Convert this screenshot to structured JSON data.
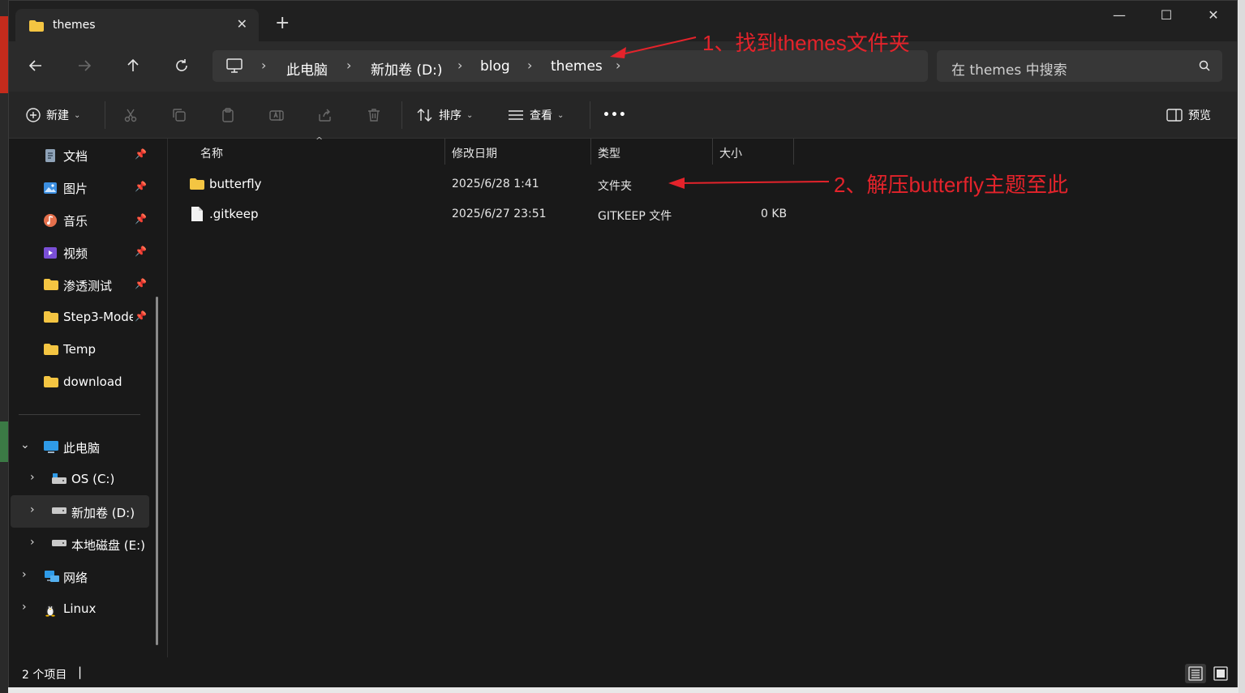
{
  "window": {
    "tab_title": "themes",
    "tab_close": "✕",
    "new_tab": "+"
  },
  "controls": {
    "minimize": "—",
    "maximize": "☐",
    "close": "✕"
  },
  "nav": {
    "breadcrumb": [
      "此电脑",
      "新加卷 (D:)",
      "blog",
      "themes"
    ],
    "search_placeholder": "在 themes 中搜索"
  },
  "toolbar": {
    "new_label": "新建",
    "sort_label": "排序",
    "view_label": "查看",
    "more_label": "•••",
    "preview_label": "预览"
  },
  "sidebar": {
    "quick_access": [
      {
        "label": "文档",
        "icon": "documents-icon",
        "pinned": true
      },
      {
        "label": "图片",
        "icon": "pictures-icon",
        "pinned": true
      },
      {
        "label": "音乐",
        "icon": "music-icon",
        "pinned": true
      },
      {
        "label": "视频",
        "icon": "videos-icon",
        "pinned": true
      },
      {
        "label": "渗透测试",
        "icon": "folder-icon",
        "pinned": true
      },
      {
        "label": "Step3-Mode",
        "icon": "folder-icon",
        "pinned": true
      },
      {
        "label": "Temp",
        "icon": "folder-icon",
        "pinned": false
      },
      {
        "label": "download",
        "icon": "folder-icon",
        "pinned": false
      }
    ],
    "this_pc": "此电脑",
    "drives": [
      {
        "label": "OS (C:)"
      },
      {
        "label": "新加卷 (D:)",
        "selected": true
      },
      {
        "label": "本地磁盘 (E:)"
      }
    ],
    "network": "网络",
    "linux": "Linux"
  },
  "file_list": {
    "columns": [
      "名称",
      "修改日期",
      "类型",
      "大小"
    ],
    "rows": [
      {
        "name": "butterfly",
        "date": "2025/6/28 1:41",
        "type": "文件夹",
        "size": "",
        "icon": "folder-icon"
      },
      {
        "name": ".gitkeep",
        "date": "2025/6/27 23:51",
        "type": "GITKEEP 文件",
        "size": "0 KB",
        "icon": "file-icon"
      }
    ]
  },
  "status": {
    "count": "2 个项目"
  },
  "annotations": {
    "step1": "1、找到themes文件夹",
    "step2": "2、解压butterfly主题至此"
  },
  "colors": {
    "window_bg": "#191919",
    "folder": "#f4c542",
    "annotation": "#e4232b"
  }
}
